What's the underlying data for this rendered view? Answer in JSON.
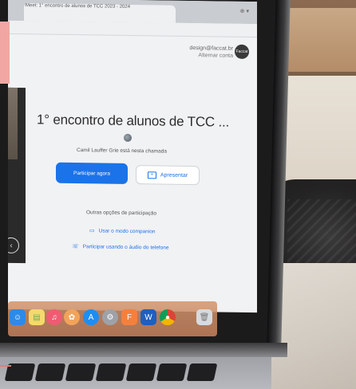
{
  "browser": {
    "tab_title": "Meet: 1° encontro de alunos de TCC 2023 - 2024",
    "tab_icons": "⊕ ▾"
  },
  "account": {
    "email": "design@faccat.br",
    "switch_label": "Alternar conta",
    "avatar_text": "Faccat"
  },
  "meeting": {
    "title": "1° encontro de alunos de TCC ...",
    "in_call_text": "Camil Lauffer Grie está nesta chamada",
    "join_label": "Participar agora",
    "present_label": "Apresentar",
    "other_options_label": "Outras opções de participação",
    "companion_label": "Usar o modo companion",
    "phone_audio_label": "Participar usando o áudio do telefone"
  },
  "dock": {
    "icons": [
      "finder-icon",
      "notes-icon",
      "music-icon",
      "photos-icon",
      "appstore-icon",
      "settings-icon",
      "files-icon",
      "word-icon",
      "chrome-icon",
      "trash-icon"
    ]
  },
  "colors": {
    "accent": "#1a73e8",
    "frame": "#f2a6a3"
  }
}
